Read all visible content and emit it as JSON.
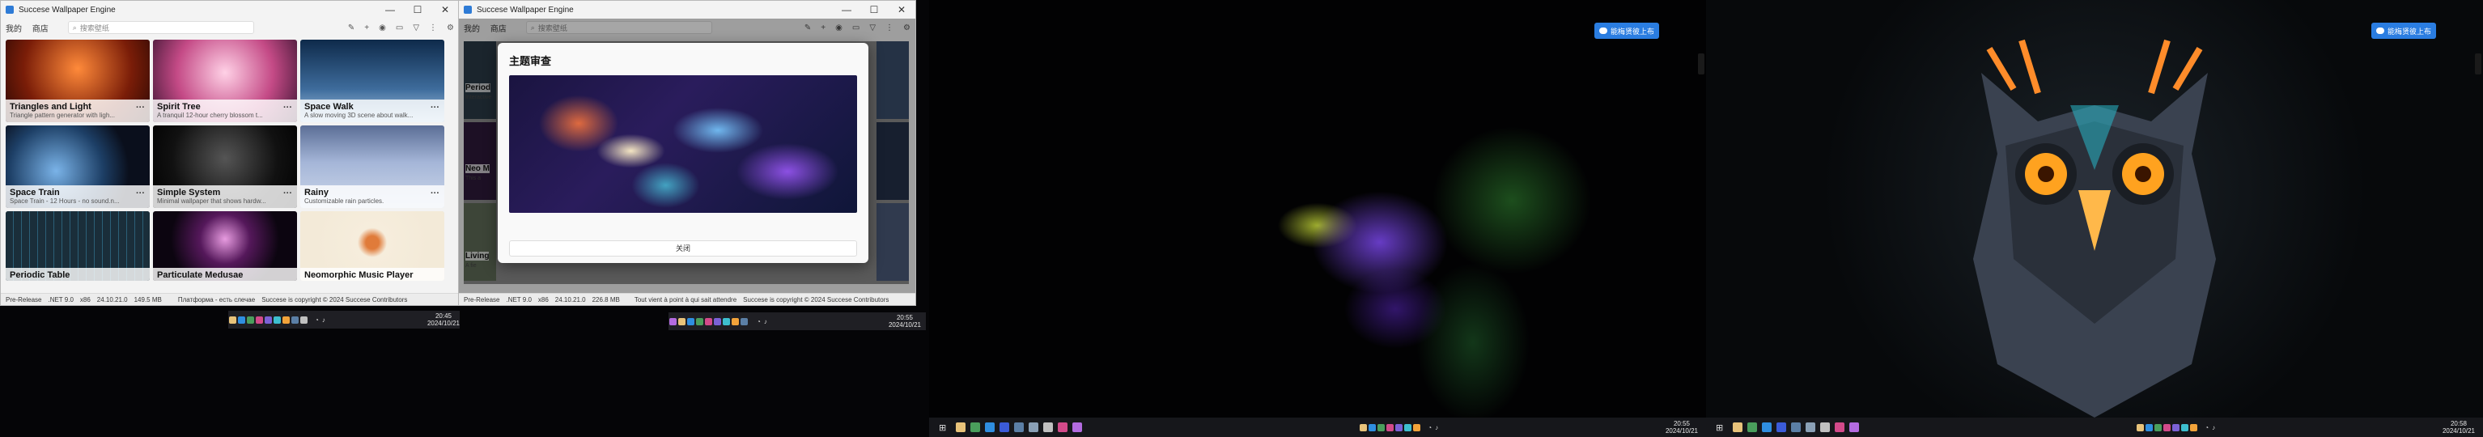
{
  "app": {
    "title": "Succese Wallpaper Engine",
    "tabs": [
      "我的",
      "商店"
    ],
    "search_placeholder": "搜索壁纸",
    "controls": [
      "—",
      "☐",
      "✕"
    ]
  },
  "left_window": {
    "cards": [
      {
        "title": "Triangles and Light",
        "desc": "Triangle pattern generator with ligh...",
        "theme": "orange"
      },
      {
        "title": "Spirit Tree",
        "desc": "A tranquil 12-hour cherry blossom t...",
        "theme": "pink"
      },
      {
        "title": "Space Walk",
        "desc": "A slow moving 3D scene about walk...",
        "theme": "blue"
      },
      {
        "title": "Space Train",
        "desc": "Space Train - 12 Hours - no sound.n...",
        "theme": "earth"
      },
      {
        "title": "Simple System",
        "desc": "Minimal wallpaper that shows hardw...",
        "theme": "grey"
      },
      {
        "title": "Rainy",
        "desc": "Customizable rain particles.",
        "theme": "rain"
      },
      {
        "title": "Periodic Table",
        "desc": "",
        "theme": "table"
      },
      {
        "title": "Particulate Medusae",
        "desc": "",
        "theme": "jelly"
      },
      {
        "title": "Neomorphic Music Player",
        "desc": "",
        "theme": "music"
      }
    ],
    "status": [
      "Pre-Release",
      ".NET 9.0",
      "x86",
      "24.10.21.0",
      "149.5 MB",
      "Платформа - есть слечае",
      "Succese is copyright © 2024 Succese Contributors"
    ],
    "clock_time": "20:45",
    "clock_date": "2024/10/21"
  },
  "right_window": {
    "side_cards": [
      "Period",
      "Neo M",
      "Living"
    ],
    "side_descs": [
      "Interactive",
      "This a",
      "A fie"
    ],
    "status": [
      "Pre-Release",
      ".NET 9.0",
      "x86",
      "24.10.21.0",
      "226.8 MB",
      "Tout vient à point à qui sait attendre",
      "Succese is copyright © 2024 Succese Contributors"
    ],
    "clock_time": "20:55",
    "clock_date": "2024/10/21"
  },
  "dialog": {
    "title": "主题审查",
    "close_label": "关闭"
  },
  "desktops": [
    {
      "badge": "能梅贤彼上布",
      "clock_time": "20:55",
      "clock_date": "2024/10/21"
    },
    {
      "badge": "能梅贤彼上布",
      "clock_time": "20:58",
      "clock_date": "2024/10/21"
    }
  ],
  "colors": {
    "accent": "#2a7de1",
    "taskbar": "#16171b"
  }
}
